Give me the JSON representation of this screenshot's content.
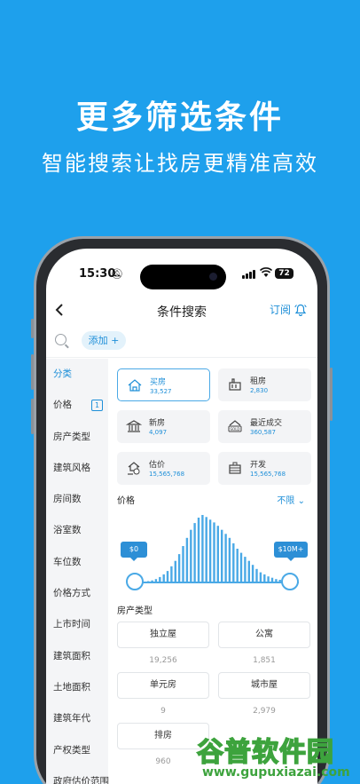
{
  "headline": "更多筛选条件",
  "subline": "智能搜索让找房更精准高效",
  "status_bar": {
    "time": "15:30",
    "battery": "72"
  },
  "nav": {
    "title": "条件搜索",
    "subscribe": "订阅"
  },
  "search": {
    "add_chip": "添加 +"
  },
  "sidebar": {
    "items": [
      {
        "label": "分类"
      },
      {
        "label": "价格",
        "badge": "1"
      },
      {
        "label": "房产类型"
      },
      {
        "label": "建筑风格"
      },
      {
        "label": "房间数"
      },
      {
        "label": "浴室数"
      },
      {
        "label": "车位数"
      },
      {
        "label": "价格方式"
      },
      {
        "label": "上市时间"
      },
      {
        "label": "建筑面积"
      },
      {
        "label": "土地面积"
      },
      {
        "label": "建筑年代"
      },
      {
        "label": "产权类型"
      },
      {
        "label": "政府估价范围"
      }
    ]
  },
  "categories": [
    {
      "name": "买房",
      "count": "33,527",
      "icon": "house-icon"
    },
    {
      "name": "租房",
      "count": "2,830",
      "icon": "rent-icon"
    },
    {
      "name": "新房",
      "count": "4,097",
      "icon": "building-icon"
    },
    {
      "name": "最近成交",
      "count": "360,587",
      "icon": "sold-icon"
    },
    {
      "name": "估价",
      "count": "15,565,768",
      "icon": "valuation-icon"
    },
    {
      "name": "开发",
      "count": "15,565,768",
      "icon": "develop-icon"
    }
  ],
  "price": {
    "label": "价格",
    "any": "不限",
    "min_label": "$0",
    "max_label": "$10M+",
    "histogram": [
      2,
      3,
      5,
      8,
      12,
      17,
      24,
      32,
      42,
      54,
      66,
      78,
      88,
      96,
      100,
      97,
      93,
      89,
      84,
      78,
      72,
      66,
      58,
      50,
      44,
      38,
      32,
      26,
      20,
      15,
      12,
      9,
      7,
      5,
      4,
      3,
      3,
      2
    ]
  },
  "property_types": {
    "label": "房产类型",
    "items": [
      {
        "name": "独立屋",
        "count": "19,256"
      },
      {
        "name": "公寓",
        "count": "1,851"
      },
      {
        "name": "单元房",
        "count": "9"
      },
      {
        "name": "城市屋",
        "count": "2,979"
      },
      {
        "name": "排房",
        "count": "960"
      }
    ]
  },
  "watermark": {
    "main": "谷普软件园",
    "url": "www.gupuxiazai.com"
  },
  "colors": {
    "background": "#1ea0ec",
    "accent": "#1e8fd8"
  }
}
